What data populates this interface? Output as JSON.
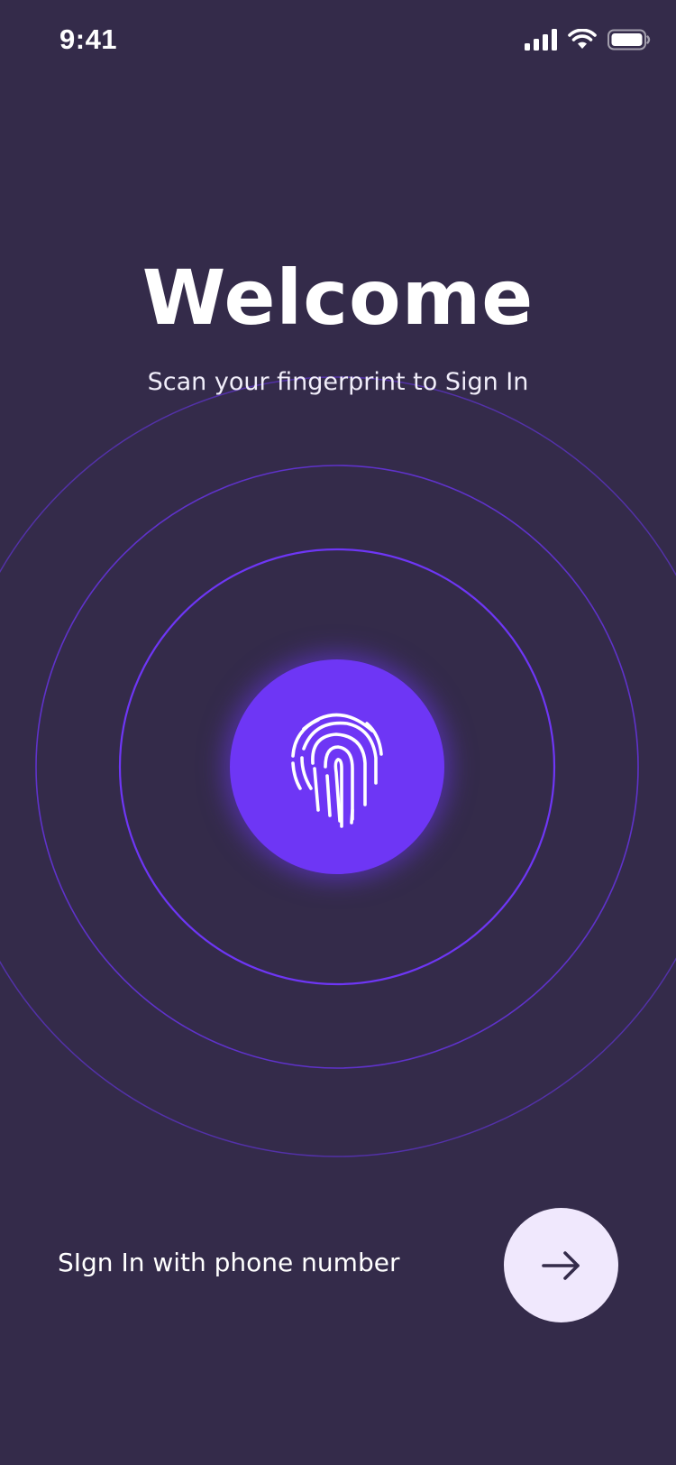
{
  "status_bar": {
    "time": "9:41",
    "icons": [
      "cellular-signal-icon",
      "wifi-icon",
      "battery-icon"
    ]
  },
  "header": {
    "title": "Welcome",
    "subtitle": "Scan your fingerprint to Sign In"
  },
  "fingerprint_button": {
    "icon": "fingerprint-icon"
  },
  "footer": {
    "phone_signin_label": "SIgn In with phone number",
    "arrow_button_icon": "arrow-right-icon"
  },
  "colors": {
    "background": "#342b4a",
    "accent": "#6e36f5",
    "ring": "#6e36f5",
    "arrow_button_bg": "#f0e8fd",
    "arrow_icon": "#342b4a",
    "text": "#ffffff"
  }
}
